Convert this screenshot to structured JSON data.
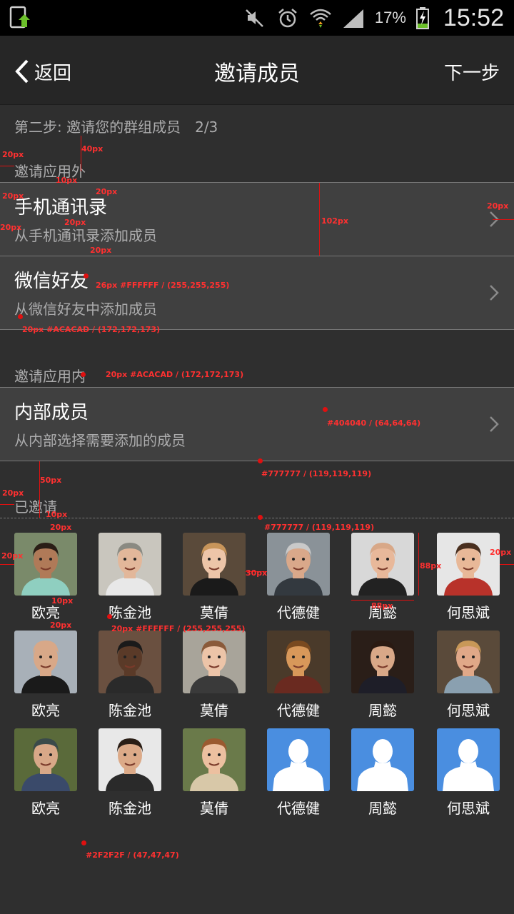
{
  "status_bar": {
    "left_icon": "app-update-icon",
    "icons": [
      "mute-icon",
      "alarm-icon",
      "wifi-icon",
      "signal-icon"
    ],
    "battery_percent": "17%",
    "time": "15:52"
  },
  "nav": {
    "back_label": "返回",
    "title": "邀请成员",
    "next_label": "下一步"
  },
  "step_text": "第二步: 邀请您的群组成员　2/3",
  "sections": {
    "outside_label": "邀请应用外",
    "inside_label": "邀请应用内",
    "invited_label": "已邀请"
  },
  "outside_rows": [
    {
      "title": "手机通讯录",
      "subtitle": "从手机通讯录添加成员"
    },
    {
      "title": "微信好友",
      "subtitle": "从微信好友中添加成员"
    }
  ],
  "inside_rows": [
    {
      "title": "内部成员",
      "subtitle": "从内部选择需要添加的成员"
    }
  ],
  "members": [
    {
      "name": "欧亮",
      "avatar": "photo",
      "bg": "#7a8a6a",
      "skin": "#b07a58",
      "hair": "#2a1e16",
      "shirt": "#8fcfc0"
    },
    {
      "name": "陈金池",
      "avatar": "photo",
      "bg": "#c9c6be",
      "skin": "#e2b79a",
      "hair": "#8a8a82",
      "shirt": "#e8e8e8"
    },
    {
      "name": "莫倩",
      "avatar": "photo",
      "bg": "#5a4a3a",
      "skin": "#edc5a8",
      "hair": "#c8955a",
      "shirt": "#1a1a1a"
    },
    {
      "name": "代德健",
      "avatar": "photo",
      "bg": "#8a9298",
      "skin": "#d9a88a",
      "hair": "#c9c9c9",
      "shirt": "#33393f"
    },
    {
      "name": "周懿",
      "avatar": "photo",
      "bg": "#d8d8d8",
      "skin": "#e8b89a",
      "hair": "#d8a888",
      "shirt": "#222"
    },
    {
      "name": "何思斌",
      "avatar": "photo",
      "bg": "#e6e6e6",
      "skin": "#e8b898",
      "hair": "#4a3020",
      "shirt": "#b8322a"
    },
    {
      "name": "欧亮",
      "avatar": "photo",
      "bg": "#a8b0b8",
      "skin": "#d8a888",
      "hair": "#d8a888",
      "shirt": "#1a1a1a"
    },
    {
      "name": "陈金池",
      "avatar": "photo",
      "bg": "#6a5040",
      "skin": "#5a3a28",
      "hair": "#1a1a1a",
      "shirt": "#2a2a2a"
    },
    {
      "name": "莫倩",
      "avatar": "photo",
      "bg": "#a8a49a",
      "skin": "#ecc4a8",
      "hair": "#8a5a3a",
      "shirt": "#3a3a3a"
    },
    {
      "name": "代德健",
      "avatar": "photo",
      "bg": "#4a3a2a",
      "skin": "#d8985a",
      "hair": "#7a4a20",
      "shirt": "#6a2a20"
    },
    {
      "name": "周懿",
      "avatar": "photo",
      "bg": "#2a1e18",
      "skin": "#d8a888",
      "hair": "#2a1a12",
      "shirt": "#1e1e28"
    },
    {
      "name": "何思斌",
      "avatar": "photo",
      "bg": "#5a4a3a",
      "skin": "#e0a888",
      "hair": "#c89858",
      "shirt": "#8aa0b0"
    },
    {
      "name": "欧亮",
      "avatar": "photo",
      "bg": "#5a6a3a",
      "skin": "#d8a888",
      "hair": "#3a4a4a",
      "shirt": "#3a4a6a"
    },
    {
      "name": "陈金池",
      "avatar": "photo",
      "bg": "#e8e8e8",
      "skin": "#dcaa88",
      "hair": "#2a1e16",
      "shirt": "#2a2a2a"
    },
    {
      "name": "莫倩",
      "avatar": "photo",
      "bg": "#6a7a4a",
      "skin": "#ecc0a0",
      "hair": "#9a5a30",
      "shirt": "#d8c8a8"
    },
    {
      "name": "代德健",
      "avatar": "placeholder",
      "bg": "#4a8ee0"
    },
    {
      "name": "周懿",
      "avatar": "placeholder",
      "bg": "#4a8ee0"
    },
    {
      "name": "何思斌",
      "avatar": "placeholder",
      "bg": "#4a8ee0"
    }
  ],
  "annotations": [
    "20px",
    "40px",
    "10px",
    "20px",
    "20px",
    "20px",
    "20px",
    "20px",
    "102px",
    "20px",
    "26px #FFFFFF / (255,255,255)",
    "20px #ACACAD / (172,172,173)",
    "20px #ACACAD / (172,172,173)",
    "#404040 / (64,64,64)",
    "#777777 / (119,119,119)",
    "50px",
    "20px",
    "10px",
    "#777777 / (119,119,119)",
    "20px",
    "20px",
    "30px",
    "88px",
    "88px",
    "20px",
    "10px",
    "20px",
    "20px #FFFFFF / (255,255,255)",
    "#2F2F2F / (47,47,47)"
  ],
  "colors": {
    "background": "#2F2F2F",
    "row_bg": "#404040",
    "divider": "#777777",
    "secondary_text": "#ACACAD",
    "primary_text": "#FFFFFF",
    "placeholder_avatar": "#4A8EE0",
    "annotation": "#FF3030"
  }
}
